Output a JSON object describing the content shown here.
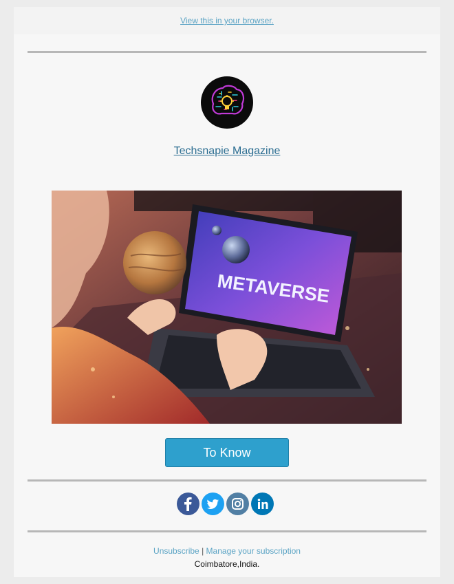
{
  "header": {
    "browser_link": "View this in your browser."
  },
  "brand": {
    "name": "Techsnapie Magazine",
    "logo_icon": "brain-lightbulb-logo"
  },
  "hero": {
    "image_icon": "metaverse-laptop-photo",
    "screen_text": "METAVERSE"
  },
  "cta": {
    "label": "To Know",
    "color": "#2ea0cd"
  },
  "social": {
    "items": [
      {
        "name": "facebook",
        "icon": "facebook-icon",
        "color": "#3b5998"
      },
      {
        "name": "twitter",
        "icon": "twitter-icon",
        "color": "#1da1f2"
      },
      {
        "name": "instagram",
        "icon": "instagram-icon",
        "color": "#517fa4"
      },
      {
        "name": "linkedin",
        "icon": "linkedin-icon",
        "color": "#0077b5"
      }
    ]
  },
  "footer": {
    "unsubscribe": "Unsubscribe",
    "separator": "|",
    "manage": "Manage your subscription",
    "address": "Coimbatore,India."
  }
}
